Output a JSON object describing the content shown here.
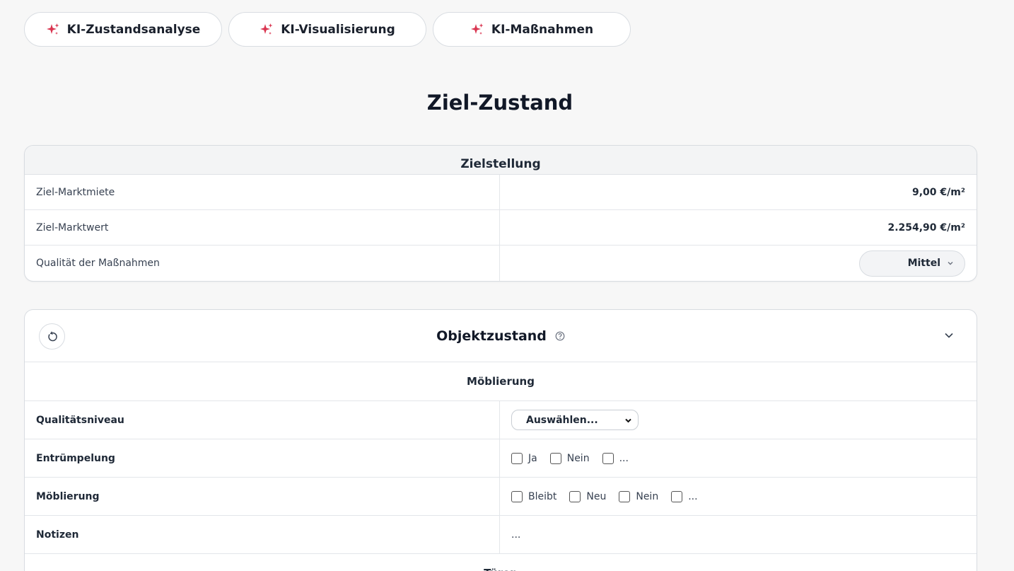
{
  "ai_buttons": [
    {
      "label": "KI-Zustandsanalyse",
      "icon": "sparkle-icon"
    },
    {
      "label": "KI-Visualisierung",
      "icon": "sparkle-icon"
    },
    {
      "label": "KI-Maßnahmen",
      "icon": "sparkle-icon"
    }
  ],
  "page_title": "Ziel-Zustand",
  "zielstellung": {
    "title": "Zielstellung",
    "rows": [
      {
        "label": "Ziel-Marktmiete",
        "value": "9,00 €/m²"
      },
      {
        "label": "Ziel-Marktwert",
        "value": "2.254,90 €/m²"
      },
      {
        "label": "Qualität der Maßnahmen",
        "select_value": "Mittel"
      }
    ]
  },
  "objektzustand": {
    "title": "Objektzustand",
    "section": "Möblierung",
    "qualitaet": {
      "label": "Qualitätsniveau",
      "select_value": "Auswählen..."
    },
    "entruempelung": {
      "label": "Entrümpelung",
      "options": [
        "Ja",
        "Nein",
        "..."
      ]
    },
    "moeblierung": {
      "label": "Möblierung",
      "options": [
        "Bleibt",
        "Neu",
        "Nein",
        "..."
      ]
    },
    "notizen": {
      "label": "Notizen",
      "value": "..."
    },
    "next_section": "Türen"
  },
  "colors": {
    "sparkle": "#d9344f",
    "text": "#1f2937",
    "border": "#e3e6ea"
  }
}
